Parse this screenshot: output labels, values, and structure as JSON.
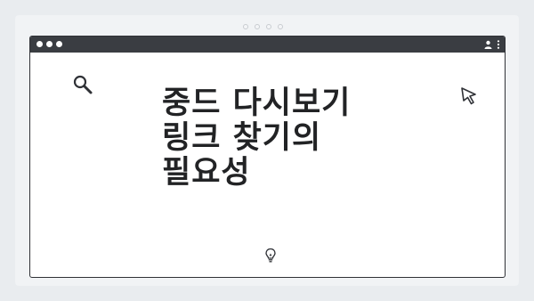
{
  "page": {
    "background_color": "#e9ecef",
    "window_frame_color": "#2f3136",
    "title_bar_color": "#3a3d42"
  },
  "icons": {
    "top_dots": [
      "dot-indicator",
      "dot-indicator",
      "dot-indicator",
      "dot-indicator"
    ],
    "window_controls": [
      "window-dot",
      "window-dot",
      "window-dot"
    ],
    "title_bar_right": [
      "user-icon",
      "kebab-menu-icon"
    ],
    "content": [
      "search-icon",
      "cursor-pointer-icon",
      "lightbulb-icon"
    ]
  },
  "headline": {
    "line1": "중드 다시보기",
    "line2": "링크 찾기의",
    "line3": "필요성"
  }
}
